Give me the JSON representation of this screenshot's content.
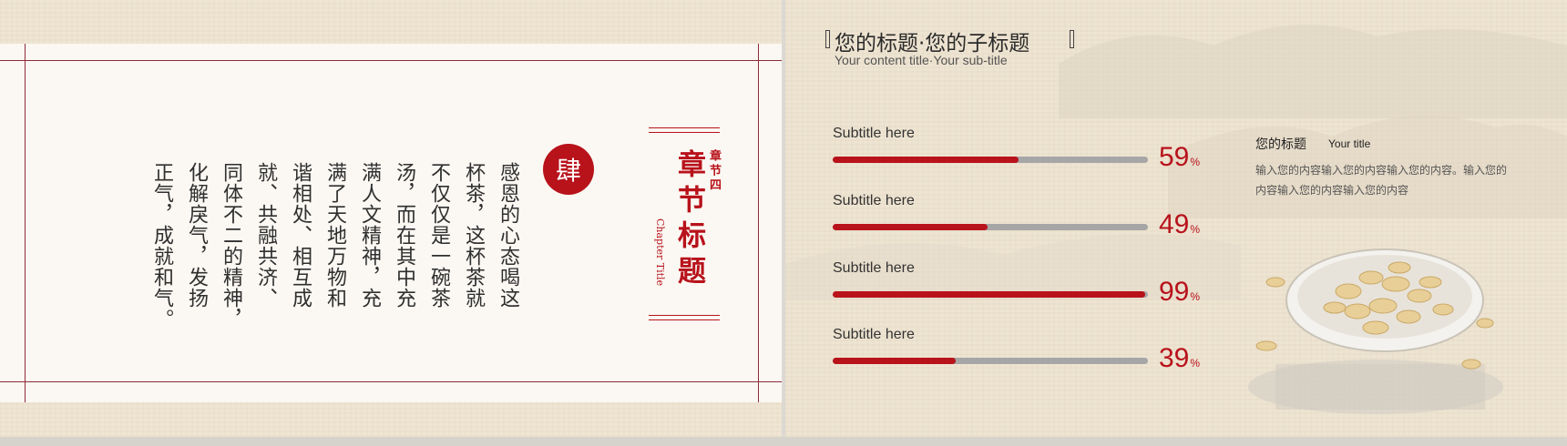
{
  "left_slide": {
    "seal_char": "肆",
    "chapter_title": "章节标题",
    "chapter_num": "章节四",
    "chapter_en": "Chapter Title",
    "poem_columns": [
      "感恩的心态喝这",
      "杯茶，这杯茶就",
      "不仅仅是一碗茶",
      "汤，而在其中充",
      "满人文精神，充",
      "满了天地万物和",
      "谐相处、相互成",
      "就、共融共济、",
      "同体不二的精神，",
      "化解戾气，发扬",
      "正气，成就和气。"
    ]
  },
  "right_slide": {
    "title": "您的标题·您的子标题",
    "subtitle": "Your content title·Your sub-title",
    "bars": [
      {
        "label": "Subtitle here",
        "value": 59,
        "value_text": "59",
        "unit": "%"
      },
      {
        "label": "Subtitle here",
        "value": 49,
        "value_text": "49",
        "unit": "%"
      },
      {
        "label": "Subtitle here",
        "value": 99,
        "value_text": "99",
        "unit": "%"
      },
      {
        "label": "Subtitle here",
        "value": 39,
        "value_text": "39",
        "unit": "%"
      }
    ],
    "side_title": "您的标题",
    "side_title_en": "Your title",
    "side_body": "输入您的内容输入您的内容输入您的内容。输入您的内容输入您的内容输入您的内容",
    "colors": {
      "accent": "#b8121b",
      "track": "#a6a6a6"
    }
  }
}
